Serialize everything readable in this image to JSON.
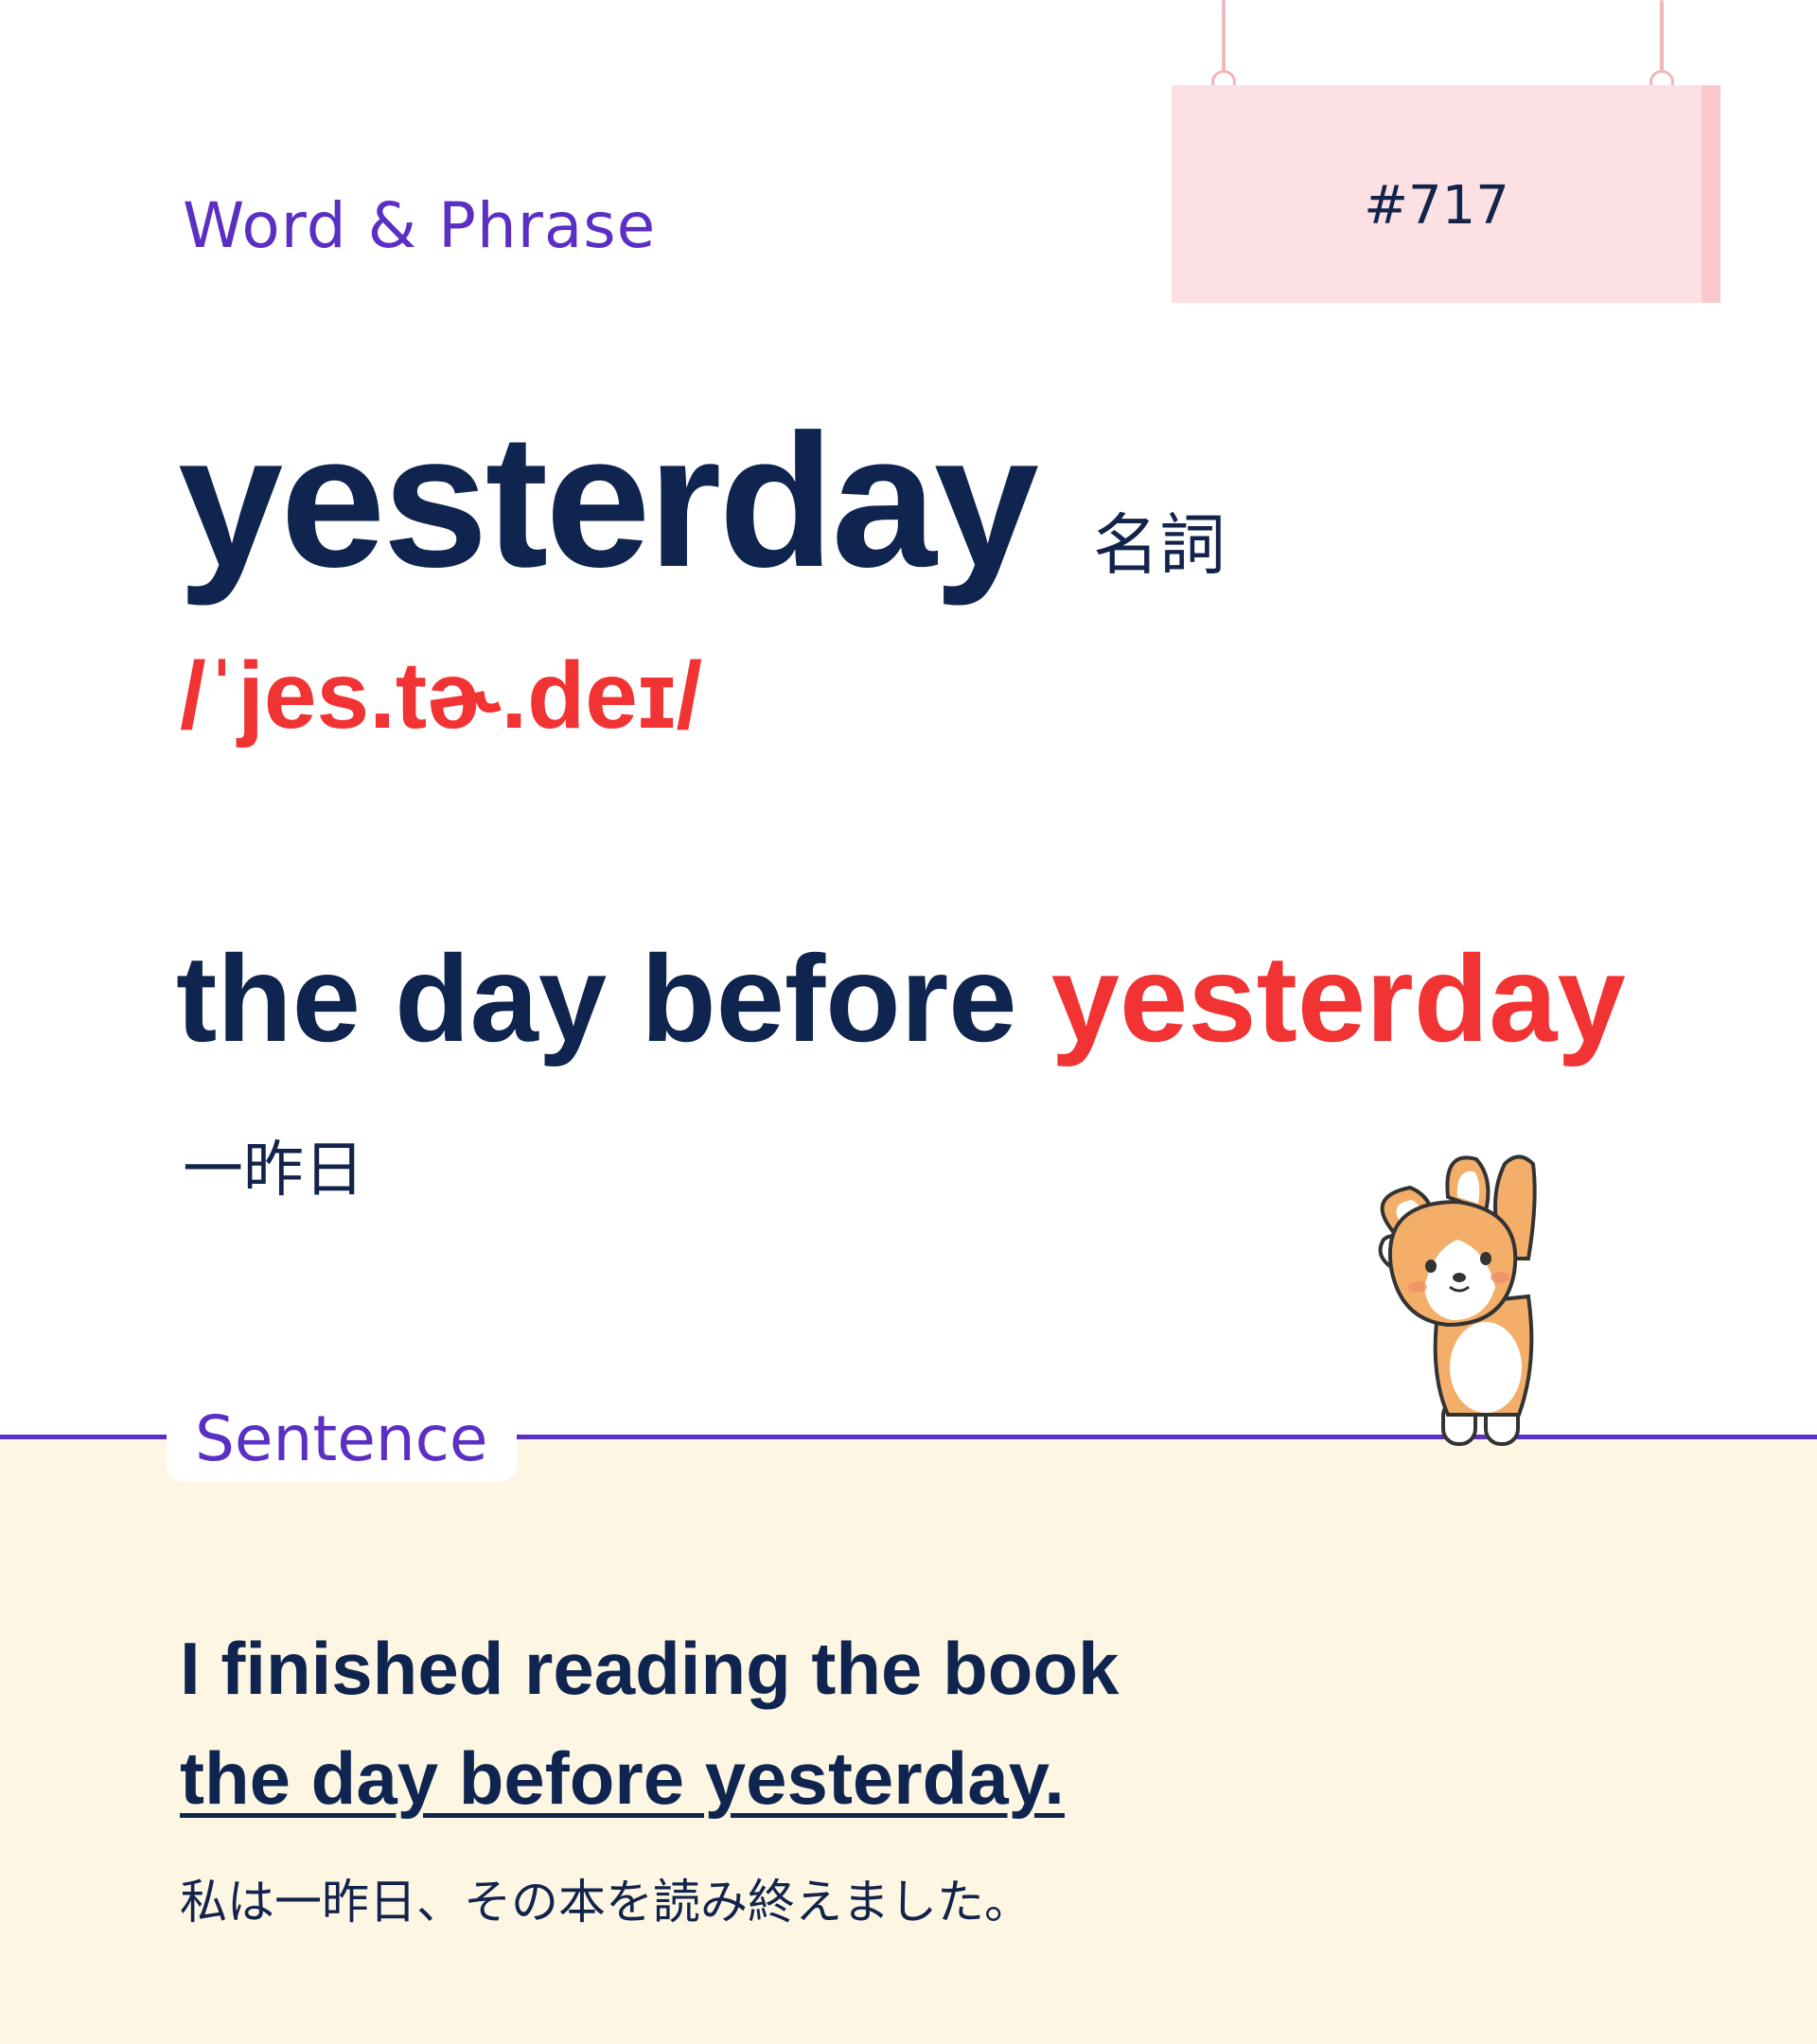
{
  "header": {
    "category": "Word & Phrase",
    "number": "#717"
  },
  "entry": {
    "word": "yesterday",
    "part_of_speech": "名詞",
    "pronunciation": "/ˈjes.tɚ.deɪ/"
  },
  "phrase": {
    "prefix": "the day before ",
    "highlight": "yesterday",
    "translation": "一昨日"
  },
  "sentence": {
    "label": "Sentence",
    "line1": "I finished reading the book",
    "line2": "the day before yesterday.",
    "translation": "私は一昨日、その本を読み終えました。"
  },
  "illustration": {
    "name": "corgi-dog"
  },
  "colors": {
    "accent_purple": "#5b2fc4",
    "navy_text": "#0f2550",
    "red_highlight": "#f23333",
    "sign_pink": "#fde0e3",
    "sentence_background": "#fdf6e3"
  }
}
